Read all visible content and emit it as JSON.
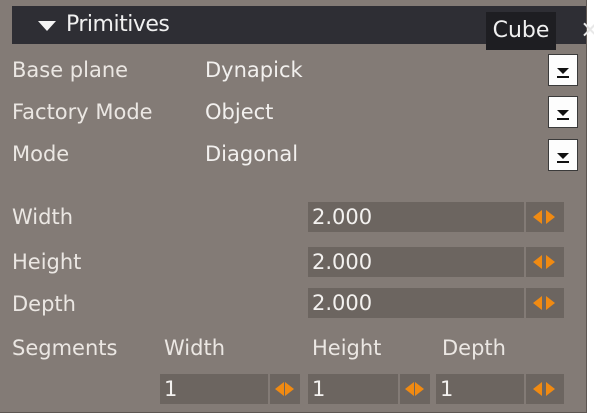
{
  "colors": {
    "panel_bg": "#837b76",
    "title_bg": "#2e2e34",
    "field_bg": "#6c6560",
    "spinner_accent": "#f08a12"
  },
  "header": {
    "title": "Primitives",
    "type_label": "Cube",
    "close_glyph": "×"
  },
  "dropdowns": [
    {
      "label": "Base plane",
      "value": "Dynapick"
    },
    {
      "label": "Factory Mode",
      "value": "Object"
    },
    {
      "label": "Mode",
      "value": "Diagonal"
    }
  ],
  "dimensions": [
    {
      "label": "Width",
      "value": "2.000"
    },
    {
      "label": "Height",
      "value": "2.000"
    },
    {
      "label": "Depth",
      "value": "2.000"
    }
  ],
  "segments": {
    "label": "Segments",
    "columns": [
      "Width",
      "Height",
      "Depth"
    ],
    "values": [
      "1",
      "1",
      "1"
    ]
  },
  "icons": [
    "collapse-arrow-icon",
    "close-icon",
    "dropdown-arrow-icon",
    "spinner-arrows-icon"
  ]
}
